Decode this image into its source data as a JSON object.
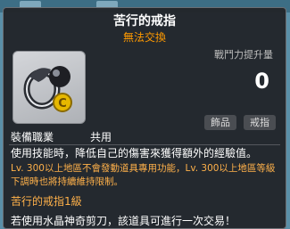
{
  "item": {
    "name": "苦行的戒指",
    "trade_status": "無法交換",
    "combat_power_label": "戰鬥力提升量",
    "combat_power_value": "0",
    "tags": [
      "飾品",
      "戒指"
    ],
    "equip_label": "裝備職業",
    "equip_value": "共用",
    "description": "使用技能時，降低自己的傷害來獲得額外的經驗值。",
    "level_note": "Lv. 300以上地區不會發動道具專用功能，Lv. 300以上地區等級下調時也將持續維持限制。",
    "effect_title": "苦行的戒指1級",
    "scissors_note": "若使用水晶神奇剪刀，該道具可進行一次交易！"
  },
  "colors": {
    "accent_orange": "#ff9a00",
    "note_orange": "#ffb14a",
    "tooltip_bg": "#222428"
  },
  "icons": {
    "item_icon": "ring-icon"
  }
}
